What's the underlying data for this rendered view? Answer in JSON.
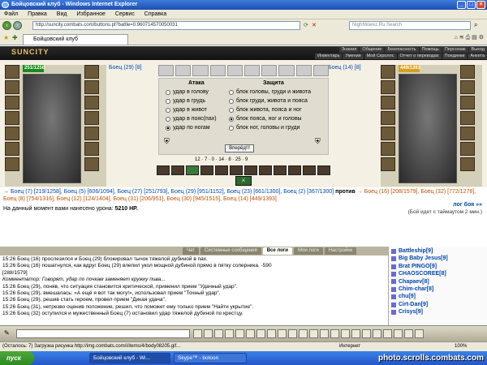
{
  "window": {
    "title": "Бойцовский клуб - Windows Internet Explorer"
  },
  "menu": [
    "Файл",
    "Правка",
    "Вид",
    "Избранное",
    "Сервис",
    "Справка"
  ],
  "address": {
    "url": "http://suncity.combats.com/buttons.pl?battle=0.960714570050031",
    "search_placeholder": "NightWarez.Ru Search"
  },
  "tab": {
    "title": "Бойцовский клуб"
  },
  "game": {
    "logo": "SUNCITY",
    "links_row1": [
      "Знания",
      "Общение",
      "Безопасность",
      "Помощь",
      "Персонаж",
      "Выход"
    ],
    "links_row2": [
      "Инвентарь",
      "Умения",
      "Мой Скроллс",
      "Отчет о переводах",
      "Поединки",
      "Анкета"
    ]
  },
  "fighters": {
    "left": {
      "name": "Боец",
      "level": "(29)",
      "rank": "[8]",
      "hp": "251/1258"
    },
    "right": {
      "name": "Боец",
      "level": "(14)",
      "rank": "[8]",
      "hp": "449/1393"
    }
  },
  "combat": {
    "attack_header": "Атака",
    "defense_header": "Защита",
    "attack": [
      {
        "label": "удар в голову",
        "selected": false
      },
      {
        "label": "удар в грудь",
        "selected": false
      },
      {
        "label": "удар в живот",
        "selected": false
      },
      {
        "label": "удар в пояс(пах)",
        "selected": false
      },
      {
        "label": "удар по ногам",
        "selected": true
      }
    ],
    "defense": [
      {
        "label": "блок головы, груди и живота",
        "selected": false
      },
      {
        "label": "блок груди, живота и пояса",
        "selected": false
      },
      {
        "label": "блок живота, пояса и ног",
        "selected": false
      },
      {
        "label": "блок пояса, ног и головы",
        "selected": true
      },
      {
        "label": "блок ног, головы и груди",
        "selected": false
      }
    ],
    "go_button": "Вперёд!!!",
    "stats": "12 · 7 · 0 · 14 · 8 · 25 · 9"
  },
  "vs": {
    "line1_prefix": "→",
    "left_team": "Боец (7) [219/1258], Боец (5) [606/1094], Боец (27) [251/793], Боец (29) [951/1152], Боец (23) [661/1300], Боец (2) [367/1300]",
    "against": "против",
    "right_team": "→ Боец (16) [208/1579], Боец (32) [772/1278], Боец (8) [754/1316], Боец (12) [124/1404], Боец (31) [206/951], Боец (30) [945/1515], Боец (14) [449/1393]"
  },
  "damage": {
    "label": "На данный момент вами нанесено урона:",
    "value": "5210 HP."
  },
  "log": {
    "link": "лог боя »»",
    "timeout": "(Бой идет с таймаутом 2 мин.)"
  },
  "chat": {
    "tabs": [
      "Чат",
      "Системные сообщения",
      "Все логи",
      "Мои логи",
      "Настройки"
    ],
    "active_tab": "Все логи",
    "lines": [
      "15:26 Боец (16) прослезился и Боец (29) блокировал тычок тяжелой дубиной в пах.",
      "15:26 Боец (16) пошатнулся, как вдруг Боец (29) влепил укол мощной дубиной прямо в пятку соперника. -590",
      "[288/1579]",
      "Комментатор: Говорят, удар по почкам заменяет кружку пива...",
      "15:26 Боец (29), поняв, что ситуация становится критической, применил прием \"Удачный удар\".",
      "15:26 Боец (29), вмешалась: «А ещё я вот так могу!», использовал прием \"Точный удар\".",
      "15:26 Боец (29), решив стать героем, провел прием \"Дикая удача\".",
      "15:26 Боец (31), нетрезво оценив положение, решил, что поможет ему только прием \"Найти укрытие\".",
      "15:26 Боец (32) оступился и мужественный Боец (7) остановил удар тяжелой дубиной по крестцу."
    ]
  },
  "users": [
    "Battleship[9]",
    "Big Baby Jesus[9]",
    "Brat PINGO[9]",
    "CHAOSCOREE[8]",
    "Chapaev[8]",
    "Chim-char[8]",
    "chu[9]",
    "Cirt-Dan[9]",
    "Crisys[9]"
  ],
  "status": {
    "left": "(Осталось: 7) Загрузка рисунка http://img.combats.com/i/items/4/body08205.gif...",
    "zone": "Интернет",
    "zoom": "100%"
  },
  "taskbar": {
    "start": "пуск",
    "tasks": [
      "Бойцовский клуб - Wi...",
      "Skype™ - botoon"
    ]
  },
  "watermark": "photo.scrolls.combats.com"
}
